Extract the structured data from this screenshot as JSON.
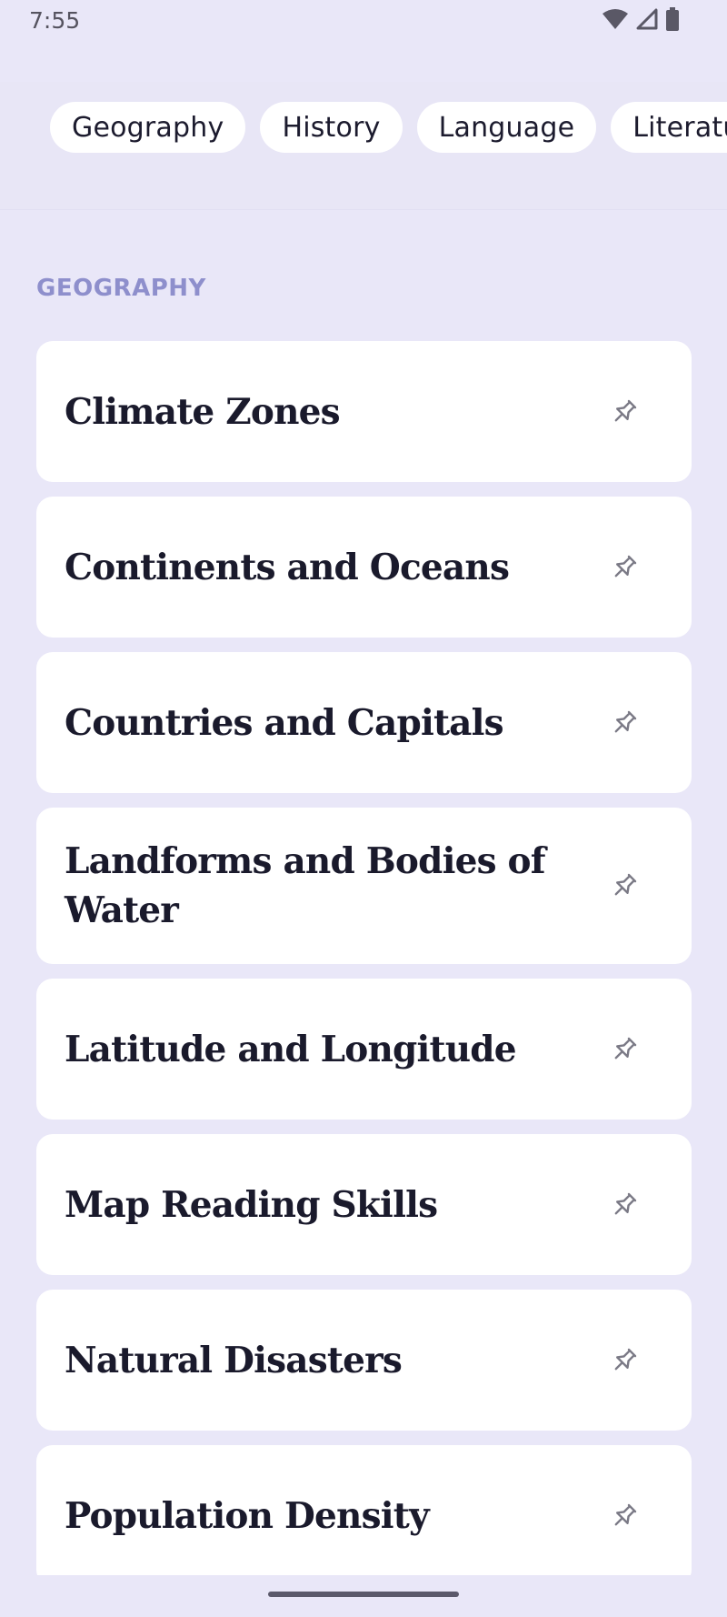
{
  "status_bar": {
    "time": "7:55",
    "icons": [
      "wifi-icon",
      "signal-icon",
      "battery-icon"
    ]
  },
  "chips": [
    {
      "label": "Geography"
    },
    {
      "label": "History"
    },
    {
      "label": "Language"
    },
    {
      "label": "Literature"
    }
  ],
  "section": {
    "title": "GEOGRAPHY",
    "items": [
      {
        "title": "Climate Zones",
        "icon": "pin-icon"
      },
      {
        "title": "Continents and Oceans",
        "icon": "pin-icon"
      },
      {
        "title": "Countries and Capitals",
        "icon": "pin-icon"
      },
      {
        "title": "Landforms and Bodies of Water",
        "icon": "pin-icon"
      },
      {
        "title": "Latitude and Longitude",
        "icon": "pin-icon"
      },
      {
        "title": "Map Reading Skills",
        "icon": "pin-icon"
      },
      {
        "title": "Natural Disasters",
        "icon": "pin-icon"
      },
      {
        "title": "Population Density",
        "icon": "pin-icon"
      }
    ]
  },
  "colors": {
    "background": "#e9e7f8",
    "card": "#ffffff",
    "section_header": "#8e8fcc",
    "text": "#1a1a2c",
    "icon": "#7b7a86"
  }
}
